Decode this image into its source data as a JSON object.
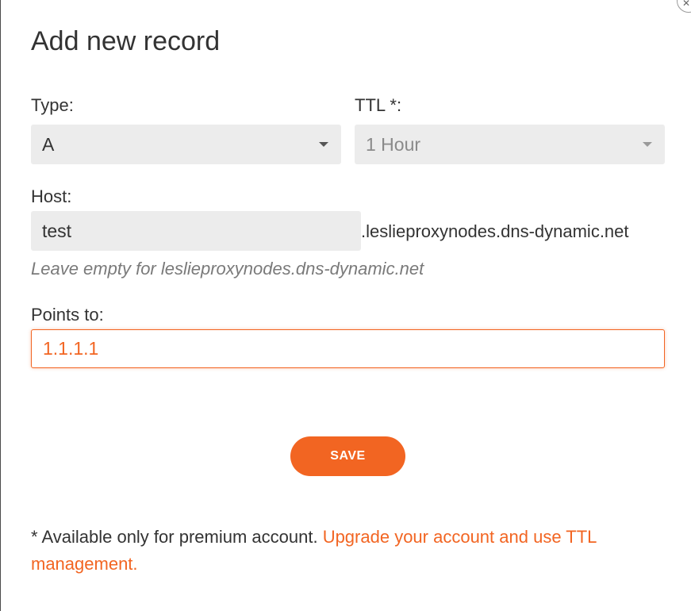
{
  "dialog": {
    "title": "Add new record",
    "close_icon": "close-icon"
  },
  "form": {
    "type": {
      "label": "Type:",
      "value": "A"
    },
    "ttl": {
      "label": "TTL *:",
      "value": "1 Hour"
    },
    "host": {
      "label": "Host:",
      "value": "test",
      "suffix": ".leslieproxynodes.dns-dynamic.net",
      "hint": "Leave empty for leslieproxynodes.dns-dynamic.net"
    },
    "points_to": {
      "label": "Points to:",
      "value": "1.1.1.1"
    },
    "save_label": "SAVE"
  },
  "footer": {
    "note": "* Available only for premium account. ",
    "upgrade_link": "Upgrade your account and use TTL management."
  },
  "colors": {
    "accent": "#f26522",
    "text": "#333333",
    "field_bg": "#ececec",
    "hint": "#7a7a7a"
  }
}
